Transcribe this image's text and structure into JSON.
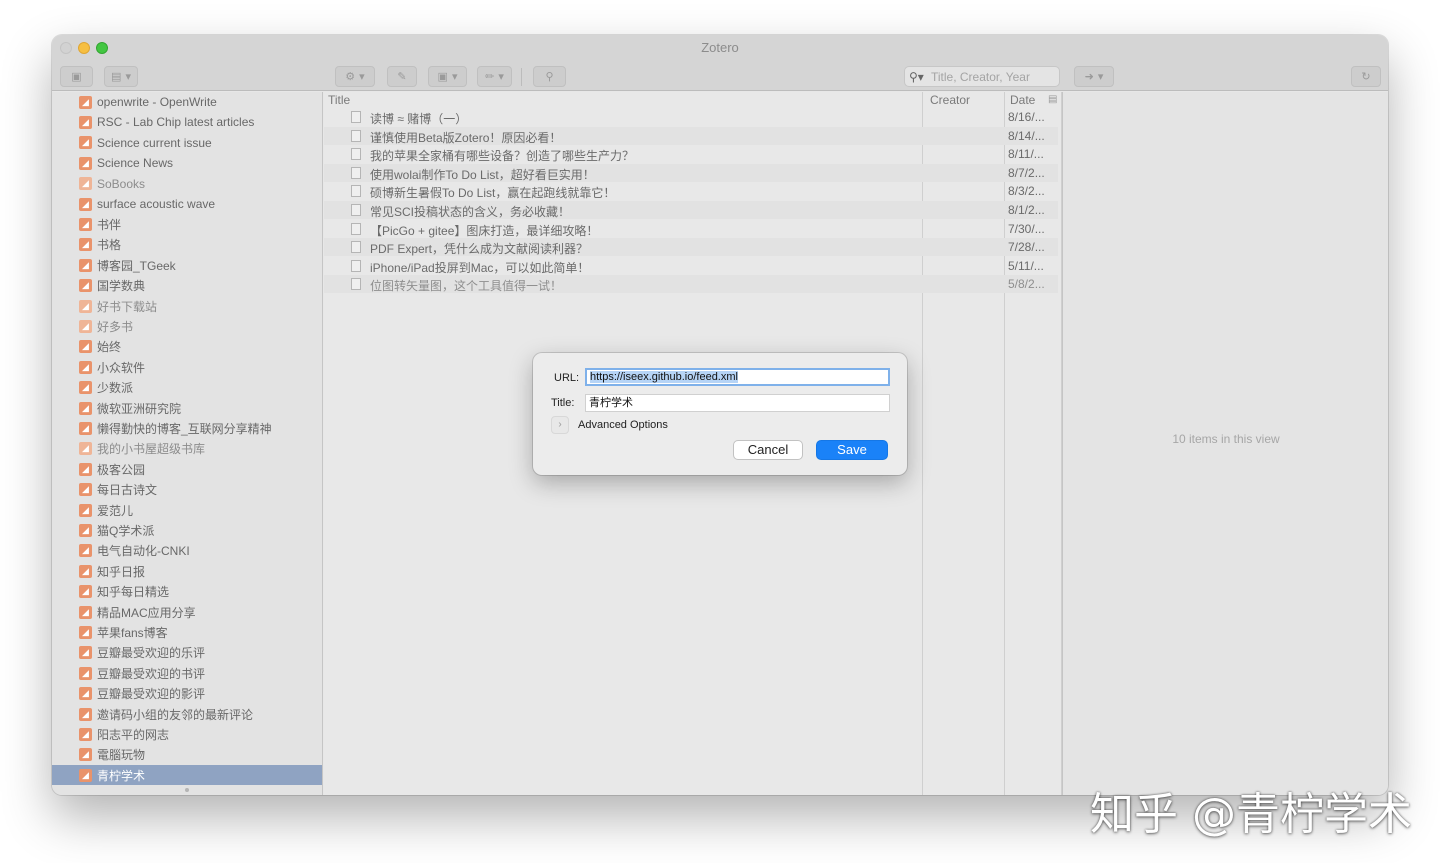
{
  "window": {
    "title": "Zotero"
  },
  "toolbar": {
    "search_placeholder": "Title, Creator, Year"
  },
  "sidebar": {
    "feeds": [
      {
        "label": "openwrite - OpenWrite",
        "dim": false
      },
      {
        "label": "RSC - Lab Chip latest articles",
        "dim": false
      },
      {
        "label": "Science current issue",
        "dim": false
      },
      {
        "label": "Science News",
        "dim": false
      },
      {
        "label": "SoBooks",
        "dim": true
      },
      {
        "label": "surface acoustic wave",
        "dim": false
      },
      {
        "label": "书伴",
        "dim": false
      },
      {
        "label": "书格",
        "dim": false
      },
      {
        "label": "博客园_TGeek",
        "dim": false
      },
      {
        "label": "国学数典",
        "dim": false
      },
      {
        "label": "好书下载站",
        "dim": true
      },
      {
        "label": "好多书",
        "dim": true
      },
      {
        "label": "始终",
        "dim": false
      },
      {
        "label": "小众软件",
        "dim": false
      },
      {
        "label": "少数派",
        "dim": false
      },
      {
        "label": "微软亚洲研究院",
        "dim": false
      },
      {
        "label": "懒得勤快的博客_互联网分享精神",
        "dim": false
      },
      {
        "label": "我的小书屋超级书库",
        "dim": true
      },
      {
        "label": "极客公园",
        "dim": false
      },
      {
        "label": "每日古诗文",
        "dim": false
      },
      {
        "label": "爱范儿",
        "dim": false
      },
      {
        "label": "猫Q学术派",
        "dim": false
      },
      {
        "label": "电气自动化-CNKI",
        "dim": false
      },
      {
        "label": "知乎日报",
        "dim": false
      },
      {
        "label": "知乎每日精选",
        "dim": false
      },
      {
        "label": "精品MAC应用分享",
        "dim": false
      },
      {
        "label": "苹果fans博客",
        "dim": false
      },
      {
        "label": "豆瓣最受欢迎的乐评",
        "dim": false
      },
      {
        "label": "豆瓣最受欢迎的书评",
        "dim": false
      },
      {
        "label": "豆瓣最受欢迎的影评",
        "dim": false
      },
      {
        "label": "邀请码小组的友邻的最新评论",
        "dim": false
      },
      {
        "label": "阳志平的网志",
        "dim": false
      },
      {
        "label": "電腦玩物",
        "dim": false
      },
      {
        "label": "青柠学术",
        "dim": false,
        "selected": true
      }
    ]
  },
  "items": {
    "columns": {
      "title": "Title",
      "creator": "Creator",
      "date": "Date"
    },
    "rows": [
      {
        "title": "读博 ≈ 赌博（一）",
        "date": "8/16/...",
        "dim": false
      },
      {
        "title": "谨慎使用Beta版Zotero！原因必看！",
        "date": "8/14/...",
        "dim": false
      },
      {
        "title": "我的苹果全家桶有哪些设备？创造了哪些生产力？",
        "date": "8/11/...",
        "dim": false
      },
      {
        "title": "使用wolai制作To Do List，超好看巨实用！",
        "date": "8/7/2...",
        "dim": false
      },
      {
        "title": "硕博新生暑假To Do List，赢在起跑线就靠它！",
        "date": "8/3/2...",
        "dim": false
      },
      {
        "title": "常见SCI投稿状态的含义，务必收藏！",
        "date": "8/1/2...",
        "dim": false
      },
      {
        "title": "【PicGo + gitee】图床打造，最详细攻略！",
        "date": "7/30/...",
        "dim": false
      },
      {
        "title": "PDF Expert，凭什么成为文献阅读利器？",
        "date": "7/28/...",
        "dim": false
      },
      {
        "title": "iPhone/iPad投屏到Mac，可以如此简单！",
        "date": "5/11/...",
        "dim": false
      },
      {
        "title": "位图转矢量图，这个工具值得一试！",
        "date": "5/8/2...",
        "dim": true
      }
    ]
  },
  "item_pane": {
    "message": "10 items in this view"
  },
  "dialog": {
    "url_label": "URL:",
    "url_value": "https://iseex.github.io/feed.xml",
    "title_label": "Title:",
    "title_value": "青柠学术",
    "advanced_label": "Advanced Options",
    "cancel_label": "Cancel",
    "save_label": "Save"
  },
  "watermark": "知乎 @青柠学术",
  "colors": {
    "accent": "#1a82f8",
    "selection": "#8fa3c2",
    "rss": "#e9936b"
  }
}
